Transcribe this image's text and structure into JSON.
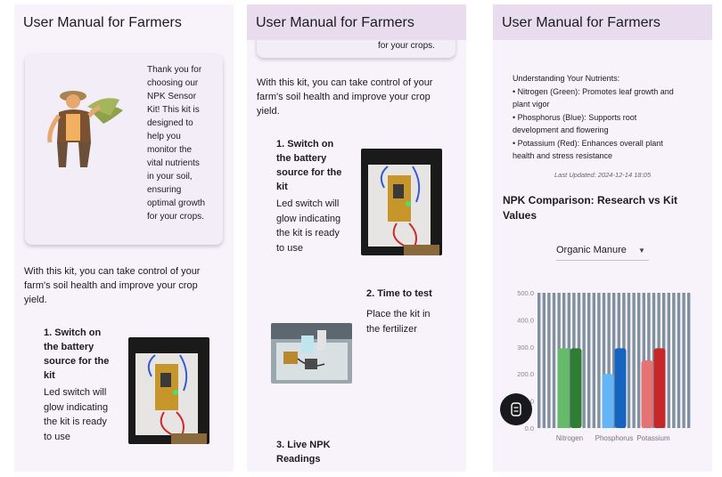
{
  "screen1": {
    "title": "User Manual for Farmers",
    "intro_card": {
      "text": [
        "Thank you for",
        "choosing our",
        "NPK Sensor",
        "Kit! This kit is",
        "designed to",
        "help you",
        "monitor the",
        "vital nutrients",
        "in your soil,",
        "ensuring",
        "optimal growth",
        "for your crops."
      ]
    },
    "control_text": [
      "With this kit, you can take control of your",
      "farm's soil health and improve your crop",
      "yield."
    ],
    "step1": {
      "title": [
        "1. Switch on",
        "the battery",
        "source for the",
        "kit"
      ],
      "desc": [
        "Led switch will",
        "glow indicating",
        "the kit is ready",
        "to use"
      ]
    }
  },
  "screen2": {
    "title": "User Manual for Farmers",
    "card_tail": "for your crops.",
    "control_text": [
      "With this kit, you can take control of your",
      "farm's soil health and improve your crop",
      "yield."
    ],
    "step1": {
      "title": [
        "1. Switch on",
        "the battery",
        "source for the",
        "kit"
      ],
      "desc": [
        "Led switch will",
        "glow indicating",
        "the kit is ready",
        "to use"
      ]
    },
    "step2": {
      "title": "2. Time to test",
      "desc": [
        "Place the kit in",
        "the fertilizer"
      ]
    },
    "step3": {
      "title": [
        "3. Live NPK",
        "Readings"
      ]
    }
  },
  "screen3": {
    "title": "User Manual for Farmers",
    "nutrients": {
      "heading": "Understanding Your Nutrients:",
      "lines": [
        "• Nitrogen (Green): Promotes leaf growth and",
        "plant vigor",
        "• Phosphorus (Blue): Supports root",
        "development and flowering",
        "• Potassium (Red): Enhances overall plant",
        "health and stress resistance"
      ]
    },
    "last_updated": "Last Updated: 2024-12-14 18:05",
    "comparison_title": [
      "NPK Comparison: Research vs Kit",
      "Values"
    ],
    "dropdown_value": "Organic Manure"
  },
  "chart_data": {
    "type": "bar",
    "categories": [
      "Nitrogen",
      "Phosphorus",
      "Potassium"
    ],
    "series": [
      {
        "values": [
          295,
          200,
          250
        ],
        "color": "#66bb6a"
      },
      {
        "values": [
          295,
          295,
          295
        ],
        "color": "#2e7d32"
      }
    ],
    "bar_colors": [
      [
        "#66bb6a",
        "#2e7d32"
      ],
      [
        "#64b5f6",
        "#1565c0"
      ],
      [
        "#e57373",
        "#c62828"
      ]
    ],
    "yticks": [
      "500.0",
      "400.0",
      "300.0",
      "200.0",
      "100.0",
      "0.0"
    ],
    "ylim": [
      0,
      500
    ],
    "grid": true
  },
  "colors": {
    "background": "#f8f2fb",
    "appbar": "#e8dcee",
    "grid": "#7f919f"
  },
  "icons": {
    "fab": "chat-bot-icon",
    "dropdown": "caret-down-icon"
  }
}
